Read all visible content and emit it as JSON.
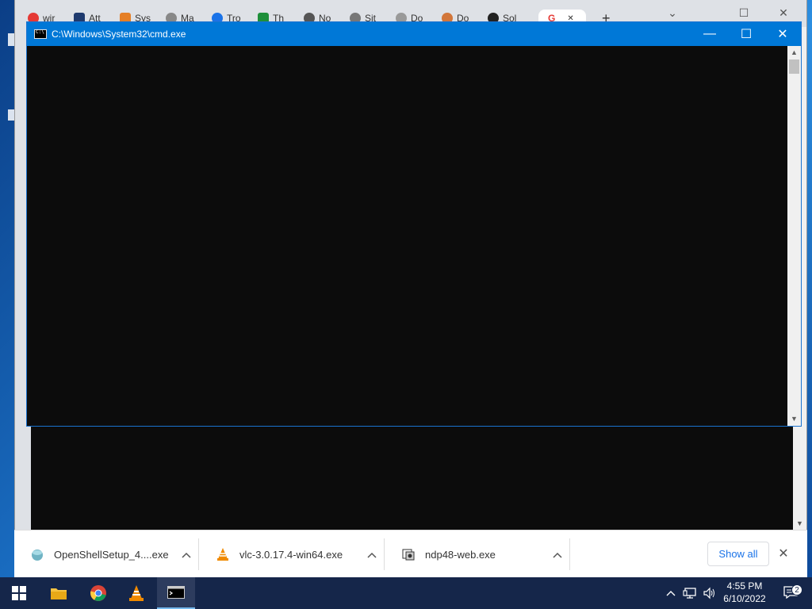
{
  "browser": {
    "tabs": [
      {
        "label": "wir",
        "color": "#e53935"
      },
      {
        "label": "Att",
        "color": "#1e3a6e"
      },
      {
        "label": "Sys",
        "color": "#e57f26"
      },
      {
        "label": "Ma",
        "color": "#888888"
      },
      {
        "label": "Tro",
        "color": "#1a73e8"
      },
      {
        "label": "Th",
        "color": "#1e8f3a"
      },
      {
        "label": "No",
        "color": "#555555"
      },
      {
        "label": "Sit",
        "color": "#777777"
      },
      {
        "label": "Do",
        "color": "#999999"
      },
      {
        "label": "Do",
        "color": "#d2763a"
      },
      {
        "label": "Sol",
        "color": "#222222"
      },
      {
        "label": "G",
        "color": "#e53935",
        "active": true
      }
    ],
    "new_tab_label": "+",
    "tab_close": "✕"
  },
  "cmd": {
    "title": "C:\\Windows\\System32\\cmd.exe",
    "minimize": "—",
    "maximize": "☐",
    "close": "✕"
  },
  "downloads": {
    "items": [
      {
        "name": "OpenShellSetup_4....exe",
        "icon": "openshell-icon"
      },
      {
        "name": "vlc-3.0.17.4-win64.exe",
        "icon": "vlc-icon"
      },
      {
        "name": "ndp48-web.exe",
        "icon": "installer-icon"
      }
    ],
    "chevron": "^",
    "show_all": "Show all",
    "close": "✕"
  },
  "taskbar": {
    "clock_time": "4:55 PM",
    "clock_date": "6/10/2022",
    "notification_count": "2",
    "tray_chevron": "^",
    "volume": "🔊",
    "network": "🖧"
  }
}
